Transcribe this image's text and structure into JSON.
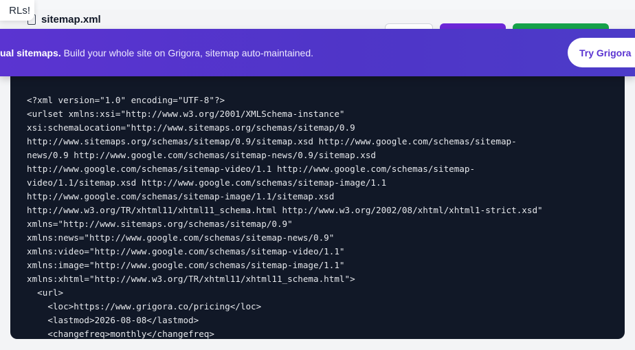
{
  "toast": {
    "text": "RLs!"
  },
  "file_header": {
    "title": "sitemap.xml",
    "icon": "file-icon"
  },
  "promo": {
    "bold_text": "ual sitemaps.",
    "text": " Build your whole site on Grigora, sitemap auto-maintained.",
    "cta_label": "Try Grigora"
  },
  "colors": {
    "promo_gradient_start": "#5b34d1",
    "promo_gradient_end": "#4c3bc8",
    "code_background": "#111827",
    "download_button": "#6d28d9",
    "validate_button": "#16a34a"
  },
  "code_lines": [
    "<?xml version=\"1.0\" encoding=\"UTF-8\"?>",
    "<urlset xmlns:xsi=\"http://www.w3.org/2001/XMLSchema-instance\"",
    "xsi:schemaLocation=\"http://www.sitemaps.org/schemas/sitemap/0.9",
    "http://www.sitemaps.org/schemas/sitemap/0.9/sitemap.xsd http://www.google.com/schemas/sitemap-",
    "news/0.9 http://www.google.com/schemas/sitemap-news/0.9/sitemap.xsd",
    "http://www.google.com/schemas/sitemap-video/1.1 http://www.google.com/schemas/sitemap-",
    "video/1.1/sitemap.xsd http://www.google.com/schemas/sitemap-image/1.1",
    "http://www.google.com/schemas/sitemap-image/1.1/sitemap.xsd",
    "http://www.w3.org/TR/xhtml11/xhtml11_schema.html http://www.w3.org/2002/08/xhtml/xhtml1-strict.xsd\"",
    "xmlns=\"http://www.sitemaps.org/schemas/sitemap/0.9\"",
    "xmlns:news=\"http://www.google.com/schemas/sitemap-news/0.9\"",
    "xmlns:video=\"http://www.google.com/schemas/sitemap-video/1.1\"",
    "xmlns:image=\"http://www.google.com/schemas/sitemap-image/1.1\"",
    "xmlns:xhtml=\"http://www.w3.org/TR/xhtml11/xhtml11_schema.html\">",
    "  <url>",
    "    <loc>https://www.grigora.co/pricing</loc>",
    "    <lastmod>2026-08-08</lastmod>",
    "    <changefreq>monthly</changefreq>"
  ]
}
